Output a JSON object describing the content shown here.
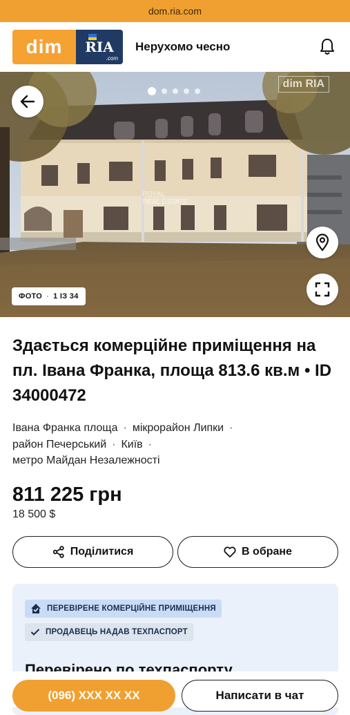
{
  "browser": {
    "url": "dom.ria.com"
  },
  "header": {
    "logo_dim": "dim",
    "logo_ria": "RIA",
    "logo_com": ".com",
    "tagline": "Нерухомо чесно"
  },
  "gallery": {
    "photo_label": "ФОТО",
    "photo_counter": "1 ІЗ 34",
    "watermark": "dim RIA",
    "agency_watermark_line1": "ROYAL",
    "agency_watermark_line2": "REAL ESTATE",
    "dots_total": 5,
    "dots_active": 1
  },
  "listing": {
    "title": "Здається комерційне приміщення на пл. Івана Франка, площа 813.6 кв.м • ID 34000472",
    "address": [
      "Івана Франка площа",
      "мікрорайон Липки",
      "район Печерський",
      "Київ",
      "метро Майдан Незалежності"
    ],
    "price": "811 225 грн",
    "price_usd": "18 500 $"
  },
  "actions": {
    "share_label": "Поділитися",
    "favorite_label": "В обране"
  },
  "verification": {
    "badge1": "ПЕРЕВІРЕНЕ КОМЕРЦІЙНЕ ПРИМІЩЕННЯ",
    "badge2": "ПРОДАВЕЦЬ НАДАВ ТЕХПАСПОРТ",
    "title": "Перевірено по техпаспорту"
  },
  "bottom_bar": {
    "phone_label": "(096) XXX XX XX",
    "chat_label": "Написати в чат"
  },
  "colors": {
    "brand_orange": "#f0a030",
    "ria_blue": "#203a63",
    "verify_bg": "#eaf1fb",
    "chip_blue": "#c8dcf7"
  }
}
